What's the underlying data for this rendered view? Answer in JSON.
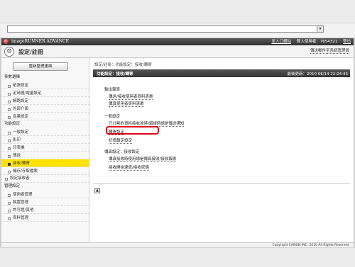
{
  "browser": {
    "address_value": "",
    "dropdown_icon": "chevron-down-icon"
  },
  "app": {
    "product_name": "imageRUNNER ADVANCE",
    "header_links": {
      "portal": "至入口網站",
      "user": "登入使用者：7654321",
      "logout": "登出"
    },
    "page_title": "設定/註冊",
    "mail_link": "傳送郵件至系統管理員"
  },
  "sidebar": {
    "refresh_label": "重新整理畫面",
    "groups": [
      {
        "label": "參數選擇",
        "items": [
          "紙張設定",
          "定時器/電量設定",
          "網路設定",
          "外部介面",
          "音量設定"
        ]
      },
      {
        "label": "功能設定",
        "items": [
          "一般設定",
          "影印",
          "印表機",
          "傳送",
          "接收/轉寄",
          "儲存/存取檔案"
        ]
      }
    ],
    "root_items": [
      "設定接收者"
    ],
    "management": {
      "label": "管理設定",
      "items": [
        "使用者管理",
        "裝置管理",
        "許可證/其他",
        "資料管理"
      ]
    },
    "active_item": "接收/轉寄"
  },
  "main": {
    "breadcrumb": "設定/註冊：功能設定：接收/轉寄",
    "section_title": "功能設定：接收/轉寄",
    "last_updated": "最後更新：2010 06/14 22:24:43",
    "blocks": [
      {
        "title": "輸出報表",
        "links": [
          "傳送/接收使用者資料清單",
          "傳真使用者資料清單"
        ]
      },
      {
        "title": "一般設定",
        "links": [
          "已分割的資料接收逾時/錯誤時總是傳送通知",
          "轉寄設定",
          "記憶鎖定設定"
        ]
      },
      {
        "title": "傳真設定：接收設定",
        "links": [
          "傳真接收時使用總是傳真接收/接收報表",
          "接收開始速度/接收密碼"
        ]
      }
    ],
    "highlighted_link": "轉寄設定",
    "top_button": "▲"
  },
  "footer": {
    "copyright": "Copyright CANON INC. 2010 All Rights Reserved"
  },
  "colors": {
    "active_nav": "#ffe300",
    "highlight_border": "#e0001a",
    "header_bg": "#333333"
  }
}
